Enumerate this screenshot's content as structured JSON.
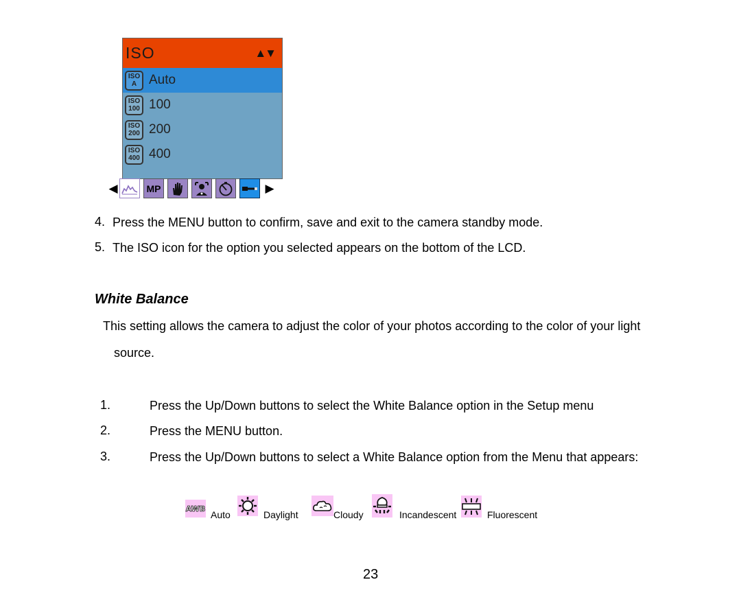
{
  "lcd_menu": {
    "title": "ISO",
    "nav_arrows": "▲▼",
    "items": [
      {
        "icon_top": "ISO",
        "icon_bottom": "A",
        "label": "Auto",
        "selected": true
      },
      {
        "icon_top": "ISO",
        "icon_bottom": "100",
        "label": "100",
        "selected": false
      },
      {
        "icon_top": "ISO",
        "icon_bottom": "200",
        "label": "200",
        "selected": false
      },
      {
        "icon_top": "ISO",
        "icon_bottom": "400",
        "label": "400",
        "selected": false
      }
    ],
    "tabbar": {
      "left_arrow": "◀",
      "right_arrow": "▶",
      "tabs": [
        {
          "name": "histogram-icon",
          "text": ""
        },
        {
          "name": "megapixel-icon",
          "text": "MP"
        },
        {
          "name": "hand-stabilizer-icon",
          "text": ""
        },
        {
          "name": "face-detect-icon",
          "text": ""
        },
        {
          "name": "self-timer-icon",
          "text": ""
        },
        {
          "name": "setup-wrench-icon",
          "text": "",
          "active": true
        }
      ]
    }
  },
  "steps_top": [
    {
      "number": "4.",
      "text": "Press the MENU button to confirm, save and exit to the camera standby mode."
    },
    {
      "number": "5.",
      "text": "The ISO icon for the option you selected appears on the bottom of the LCD."
    }
  ],
  "section": {
    "heading": "White Balance",
    "intro_line1": "This setting allows the camera to adjust the color of your photos according to the color of your light",
    "intro_line2": "source."
  },
  "steps_wb": [
    {
      "number": "1.",
      "text": "Press the Up/Down buttons to select the White Balance option in the Setup menu"
    },
    {
      "number": "2.",
      "text": "Press the MENU button."
    },
    {
      "number": "3.",
      "text": "Press the Up/Down buttons to select a White Balance option from the Menu that appears:"
    }
  ],
  "wb_options": [
    {
      "icon": "awb-icon",
      "icon_text": "AWB",
      "label": "Auto"
    },
    {
      "icon": "daylight-sun-icon",
      "label": "Daylight"
    },
    {
      "icon": "cloudy-icon",
      "label": "Cloudy"
    },
    {
      "icon": "incandescent-bulb-icon",
      "label": "Incandescent"
    },
    {
      "icon": "fluorescent-tube-icon",
      "label": "Fluorescent"
    }
  ],
  "page_number": "23"
}
